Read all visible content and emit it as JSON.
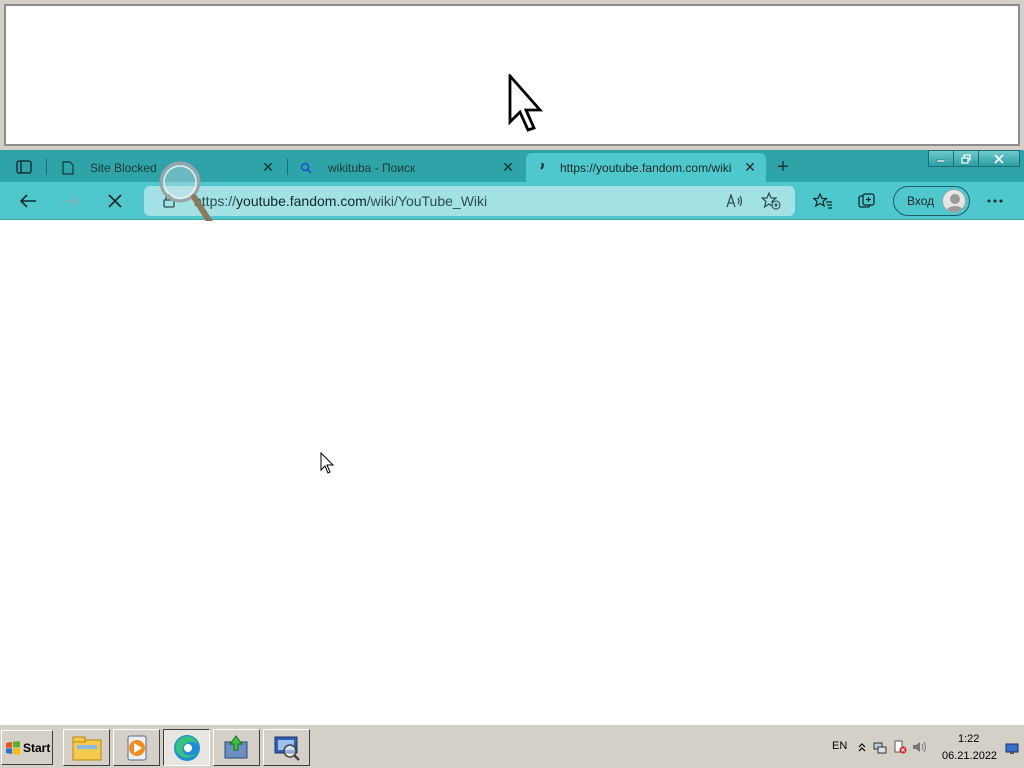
{
  "browser": {
    "tabs": [
      {
        "label": "Site Blocked",
        "icon": "page-icon",
        "active": false
      },
      {
        "label": "wikituba - Поиск",
        "icon": "search-icon",
        "active": false
      },
      {
        "label": "https://youtube.fandom.com/wiki",
        "icon": "loading-icon",
        "active": true
      }
    ],
    "new_tab_label": "+",
    "address": {
      "prefix": "https://",
      "host": "youtube.fandom.com",
      "path": "/wiki/YouTube_Wiki"
    },
    "signin_label": "Вход"
  },
  "taskbar": {
    "start_label": "Start",
    "language": "EN",
    "time": "1:22",
    "date": "06.21.2022"
  },
  "colors": {
    "tabstrip": "#2ea3a8",
    "toolbar": "#4ec8cc",
    "address_bar": "#a3e2e4",
    "taskbar": "#d4d0c8"
  }
}
